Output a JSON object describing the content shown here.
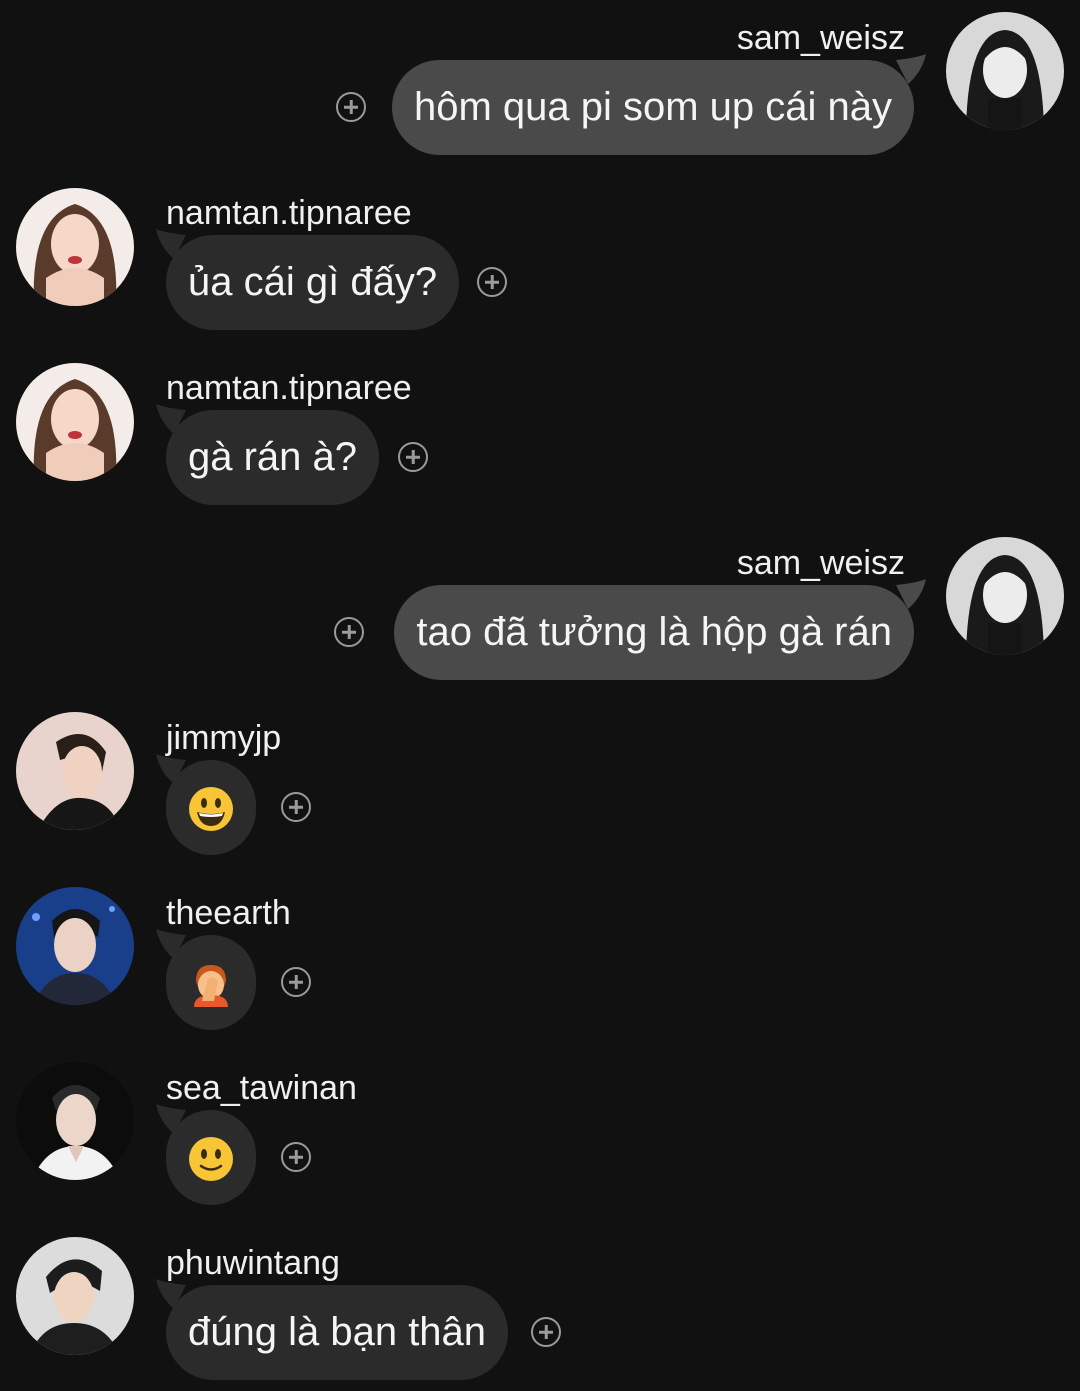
{
  "messages": [
    {
      "id": "m1",
      "user": "sam_weisz",
      "side": "mine",
      "text": "hôm qua pi som up cái này"
    },
    {
      "id": "m2",
      "user": "namtan.tipnaree",
      "side": "theirs",
      "text": "ủa cái gì đấy?"
    },
    {
      "id": "m3",
      "user": "namtan.tipnaree",
      "side": "theirs",
      "text": "gà rán à?"
    },
    {
      "id": "m4",
      "user": "sam_weisz",
      "side": "mine",
      "text": "tao đã tưởng là hộp gà rán"
    },
    {
      "id": "m5",
      "user": "jimmyjp",
      "side": "theirs",
      "emoji": "grinning-face"
    },
    {
      "id": "m6",
      "user": "theearth",
      "side": "theirs",
      "emoji": "person-facepalming"
    },
    {
      "id": "m7",
      "user": "sea_tawinan",
      "side": "theirs",
      "emoji": "slightly-smiling-face"
    },
    {
      "id": "m8",
      "user": "phuwintang",
      "side": "theirs",
      "text": "đúng là bạn thân"
    }
  ],
  "icons": {
    "react": "add-reaction-icon"
  },
  "colors": {
    "background": "#111111",
    "bubble_mine": "#4a4a4a",
    "bubble_theirs": "#2b2b2b",
    "text": "#f5f5f5",
    "icon": "#9a9a9a"
  }
}
